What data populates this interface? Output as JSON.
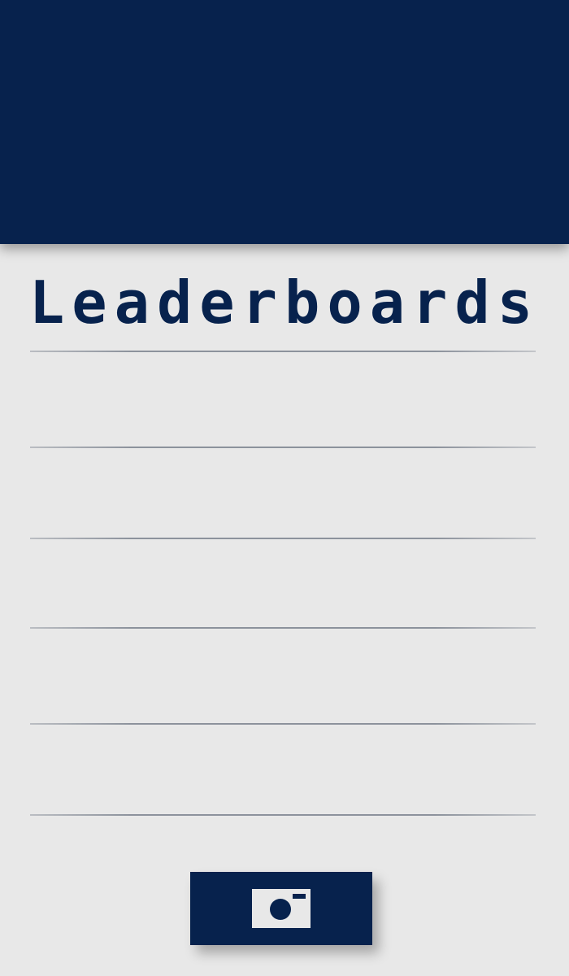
{
  "screen": {
    "title": "Leaderboards",
    "colors": {
      "primary": "#07224d",
      "background": "#e8e8e8",
      "divider": "#8c929c"
    }
  },
  "leaderboard": {
    "rows": [
      {
        "rank": "",
        "name": "",
        "score": ""
      },
      {
        "rank": "",
        "name": "",
        "score": ""
      },
      {
        "rank": "",
        "name": "",
        "score": ""
      },
      {
        "rank": "",
        "name": "",
        "score": ""
      },
      {
        "rank": "",
        "name": "",
        "score": ""
      }
    ]
  },
  "footer": {
    "camera_button_icon": "camera-icon"
  }
}
